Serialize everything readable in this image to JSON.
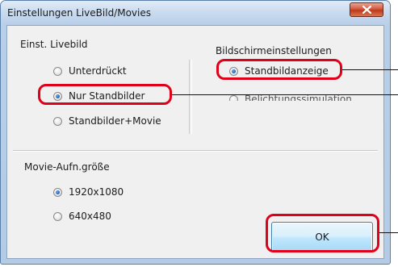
{
  "window": {
    "title": "Einstellungen LiveBild/Movies"
  },
  "livebild": {
    "heading": "Einst. Livebild",
    "options": [
      {
        "label": "Unterdrückt",
        "checked": false
      },
      {
        "label": "Nur Standbilder",
        "checked": true
      },
      {
        "label": "Standbilder+Movie",
        "checked": false
      }
    ]
  },
  "screen": {
    "heading": "Bildschirmeinstellungen",
    "options": [
      {
        "label": "Standbildanzeige",
        "checked": true
      },
      {
        "label": "Belichtungssimulation",
        "checked": false
      }
    ]
  },
  "movie": {
    "heading": "Movie-Aufn.größe",
    "options": [
      {
        "label": "1920x1080",
        "checked": true
      },
      {
        "label": "640x480",
        "checked": false
      }
    ]
  },
  "buttons": {
    "ok": "OK"
  },
  "colors": {
    "highlight": "#e1001a",
    "title_bar": "#c6d9ee",
    "close_button": "#d1593f"
  }
}
